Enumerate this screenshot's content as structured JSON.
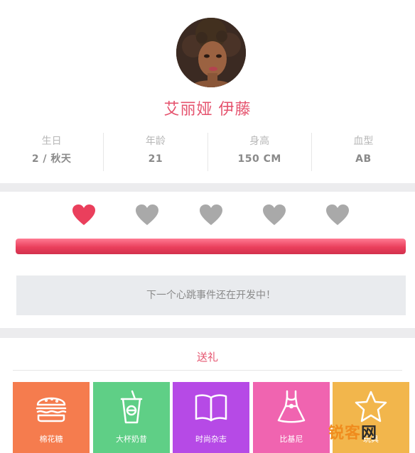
{
  "profile": {
    "name": "艾丽娅 伊藤",
    "stats": [
      {
        "label": "生日",
        "value": "2 / 秋天"
      },
      {
        "label": "年龄",
        "value": "21"
      },
      {
        "label": "身高",
        "value": "150 CM"
      },
      {
        "label": "血型",
        "value": "AB"
      }
    ]
  },
  "affection": {
    "hearts_filled": 1,
    "hearts_total": 5,
    "progress": 1.0,
    "notice": "下一个心跳事件还在开发中！"
  },
  "gifts": {
    "title": "送礼",
    "items": [
      {
        "label": "棉花糖",
        "icon": "burger-icon",
        "color": "#f57c4e"
      },
      {
        "label": "大杯奶昔",
        "icon": "milkshake-icon",
        "color": "#5fcf86"
      },
      {
        "label": "时尚杂志",
        "icon": "magazine-icon",
        "color": "#b64ae6"
      },
      {
        "label": "比基尼",
        "icon": "dress-icon",
        "color": "#f064b0"
      },
      {
        "label": "玩具",
        "icon": "star-icon",
        "color": "#f2b64c"
      }
    ]
  },
  "watermark": {
    "part1": "锐客",
    "part2": "网"
  },
  "colors": {
    "accent": "#e5536e",
    "heart_on": "#ea3f5c",
    "heart_off": "#a9a9a9"
  }
}
